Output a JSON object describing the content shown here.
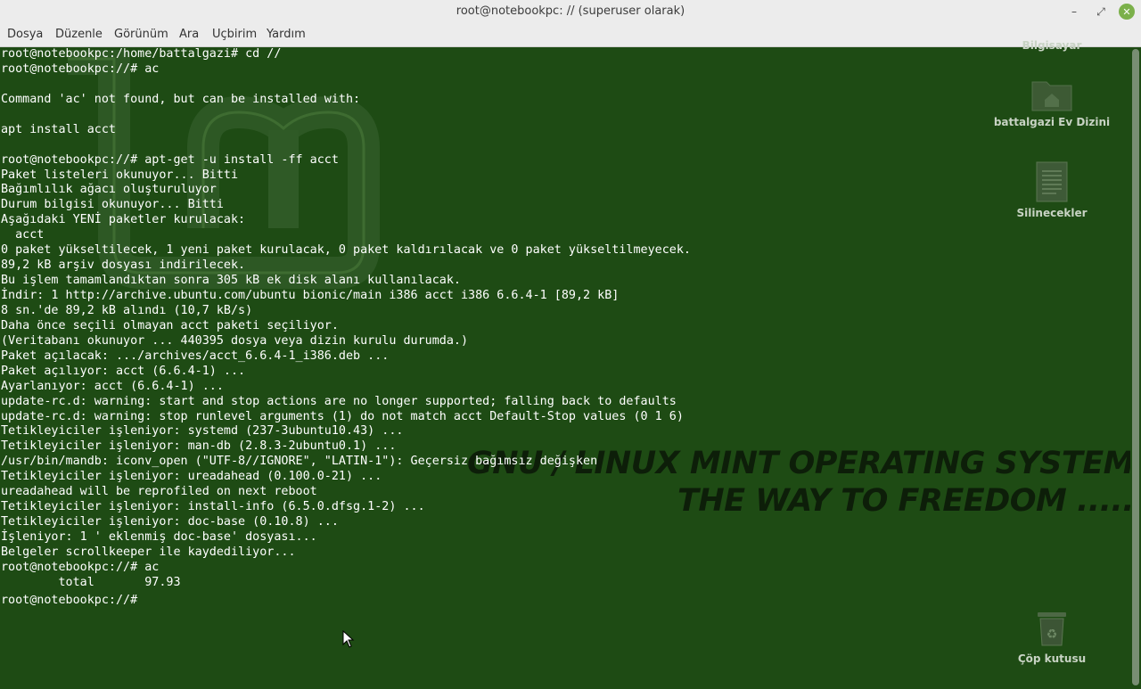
{
  "window": {
    "title": "root@notebookpc: // (superuser olarak)",
    "minimize_glyph": "–",
    "maximize_glyph": "⤢",
    "close_glyph": "✕"
  },
  "menu": [
    "Dosya",
    "Düzenle",
    "Görünüm",
    "Ara",
    "Uçbirim",
    "Yardım"
  ],
  "terminal": {
    "lines": [
      "root@notebookpc:/home/battalgazi# cd //",
      "root@notebookpc://# ac",
      "",
      "Command 'ac' not found, but can be installed with:",
      "",
      "apt install acct",
      "",
      "root@notebookpc://# apt-get -u install -ff acct",
      "Paket listeleri okunuyor... Bitti",
      "Bağımlılık ağacı oluşturuluyor",
      "Durum bilgisi okunuyor... Bitti",
      "Aşağıdaki YENİ paketler kurulacak:",
      "  acct",
      "0 paket yükseltilecek, 1 yeni paket kurulacak, 0 paket kaldırılacak ve 0 paket yükseltilmeyecek.",
      "89,2 kB arşiv dosyası indirilecek.",
      "Bu işlem tamamlandıktan sonra 305 kB ek disk alanı kullanılacak.",
      "İndir: 1 http://archive.ubuntu.com/ubuntu bionic/main i386 acct i386 6.6.4-1 [89,2 kB]",
      "8 sn.'de 89,2 kB alındı (10,7 kB/s)",
      "Daha önce seçili olmayan acct paketi seçiliyor.",
      "(Veritabanı okunuyor ... 440395 dosya veya dizin kurulu durumda.)",
      "Paket açılacak: .../archives/acct_6.6.4-1_i386.deb ...",
      "Paket açılıyor: acct (6.6.4-1) ...",
      "Ayarlanıyor: acct (6.6.4-1) ...",
      "update-rc.d: warning: start and stop actions are no longer supported; falling back to defaults",
      "update-rc.d: warning: stop runlevel arguments (1) do not match acct Default-Stop values (0 1 6)",
      "Tetikleyiciler işleniyor: systemd (237-3ubuntu10.43) ...",
      "Tetikleyiciler işleniyor: man-db (2.8.3-2ubuntu0.1) ...",
      "/usr/bin/mandb: iconv_open (\"UTF-8//IGNORE\", \"LATIN-1\"): Geçersiz bağımsız değişken",
      "Tetikleyiciler işleniyor: ureadahead (0.100.0-21) ...",
      "ureadahead will be reprofiled on next reboot",
      "Tetikleyiciler işleniyor: install-info (6.5.0.dfsg.1-2) ...",
      "Tetikleyiciler işleniyor: doc-base (0.10.8) ...",
      "İşleniyor: 1 ' eklenmiş doc-base' dosyası...",
      "Belgeler scrollkeeper ile kaydediliyor...",
      "root@notebookpc://# ac",
      "        total       97.93",
      "root@notebookpc://# "
    ]
  },
  "wallpaper": {
    "slogan_line1": "GNU / LINUX MINT OPERATING SYSTEM",
    "slogan_line2": "THE WAY TO FREEDOM .....",
    "logo_text": "lm"
  },
  "desktop_icons": [
    {
      "label": "Bilgisayar",
      "icon": "computer-icon"
    },
    {
      "label": "battalgazi Ev Dizini",
      "icon": "home-folder-icon"
    },
    {
      "label": "Silinecekler",
      "icon": "document-icon"
    },
    {
      "label": "Çöp kutusu",
      "icon": "trash-icon"
    }
  ],
  "colors": {
    "terminal_bg": "#1e4b14",
    "titlebar_bg": "#ececec",
    "close_button": "#7bb04a",
    "text": "#ffffff"
  }
}
